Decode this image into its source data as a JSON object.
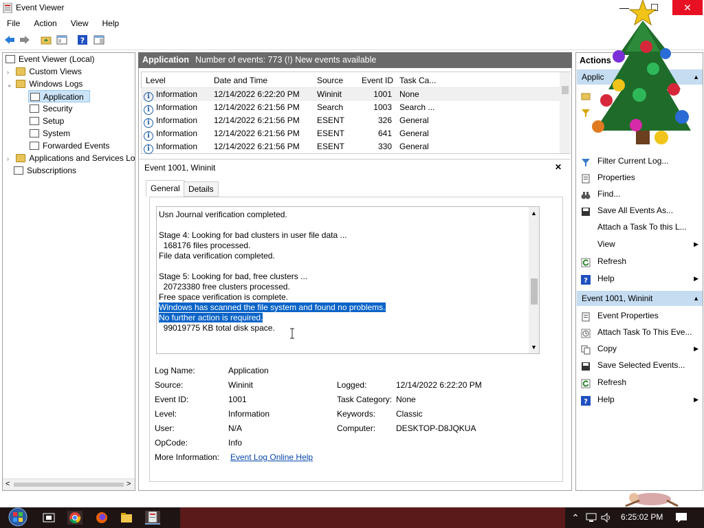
{
  "window": {
    "title": "Event Viewer",
    "controls": {
      "minimize": "—",
      "maximize": "☐",
      "close": "✕"
    }
  },
  "menu": [
    "File",
    "Action",
    "View",
    "Help"
  ],
  "toolbar": {
    "icons": [
      "back-arrow-icon",
      "forward-arrow-icon",
      "open-folder-icon",
      "console-tree-icon",
      "help-icon",
      "show-hide-action-pane-icon"
    ]
  },
  "tree": {
    "root": "Event Viewer (Local)",
    "custom_views": "Custom Views",
    "windows_logs": "Windows Logs",
    "logs": [
      "Application",
      "Security",
      "Setup",
      "System",
      "Forwarded Events"
    ],
    "apps_services": "Applications and Services Lo",
    "subscriptions": "Subscriptions",
    "scroll_left": "<",
    "scroll_right": ">"
  },
  "center": {
    "log_name": "Application",
    "summary": "Number of events: 773 (!) New events available"
  },
  "grid": {
    "columns": [
      "Level",
      "Date and Time",
      "Source",
      "Event ID",
      "Task Ca..."
    ],
    "rows": [
      {
        "level": "Information",
        "datetime": "12/14/2022 6:22:20 PM",
        "source": "Wininit",
        "event_id": "1001",
        "task": "None"
      },
      {
        "level": "Information",
        "datetime": "12/14/2022 6:21:56 PM",
        "source": "Search",
        "event_id": "1003",
        "task": "Search ..."
      },
      {
        "level": "Information",
        "datetime": "12/14/2022 6:21:56 PM",
        "source": "ESENT",
        "event_id": "326",
        "task": "General"
      },
      {
        "level": "Information",
        "datetime": "12/14/2022 6:21:56 PM",
        "source": "ESENT",
        "event_id": "641",
        "task": "General"
      },
      {
        "level": "Information",
        "datetime": "12/14/2022 6:21:56 PM",
        "source": "ESENT",
        "event_id": "330",
        "task": "General"
      }
    ],
    "info_glyph": "i"
  },
  "detail": {
    "title": "Event 1001, Wininit",
    "close": "✕",
    "tabs": [
      "General",
      "Details"
    ],
    "message_before": "Usn Journal verification completed.\n\nStage 4: Looking for bad clusters in user file data ...\n  168176 files processed.\nFile data verification completed.\n\nStage 5: Looking for bad, free clusters ...\n  20723380 free clusters processed.\nFree space verification is complete.\n",
    "message_highlight_1": "Windows has scanned the file system and found no problems.",
    "message_highlight_2": "No further action is required.",
    "message_after": "\n  99019775 KB total disk space.",
    "fields": {
      "log_name_label": "Log Name:",
      "log_name": "Application",
      "source_label": "Source:",
      "source": "Wininit",
      "logged_label": "Logged:",
      "logged": "12/14/2022 6:22:20 PM",
      "event_id_label": "Event ID:",
      "event_id": "1001",
      "task_category_label": "Task Category:",
      "task_category": "None",
      "level_label": "Level:",
      "level": "Information",
      "keywords_label": "Keywords:",
      "keywords": "Classic",
      "user_label": "User:",
      "user": "N/A",
      "computer_label": "Computer:",
      "computer": "DESKTOP-D8JQKUA",
      "opcode_label": "OpCode:",
      "opcode": "Info",
      "more_info_label": "More Information:",
      "more_info_link": "Event Log Online Help"
    }
  },
  "actions": {
    "header": "Actions",
    "section1": "Applic",
    "section1_items": [
      "Filter Current Log...",
      "Properties",
      "Find...",
      "Save All Events As...",
      "Attach a Task To this L...",
      "View",
      "Refresh",
      "Help"
    ],
    "section2": "Event 1001, Wininit",
    "section2_items": [
      "Event Properties",
      "Attach Task To This Eve...",
      "Copy",
      "Save Selected Events...",
      "Refresh",
      "Help"
    ]
  },
  "taskbar": {
    "time": "6:25:02 PM",
    "icons": [
      "start-orb-icon",
      "task-view-icon",
      "chrome-icon",
      "firefox-icon",
      "file-explorer-icon",
      "event-viewer-taskbar-icon"
    ],
    "tray": [
      "chevron-up-icon",
      "network-icon",
      "speaker-icon",
      "notification-icon"
    ]
  },
  "colors": {
    "header_gray": "#6a6a6a",
    "selection_blue": "#0a64c8",
    "section_blue": "#c5dcf1",
    "taskbar": "#1e1414"
  }
}
